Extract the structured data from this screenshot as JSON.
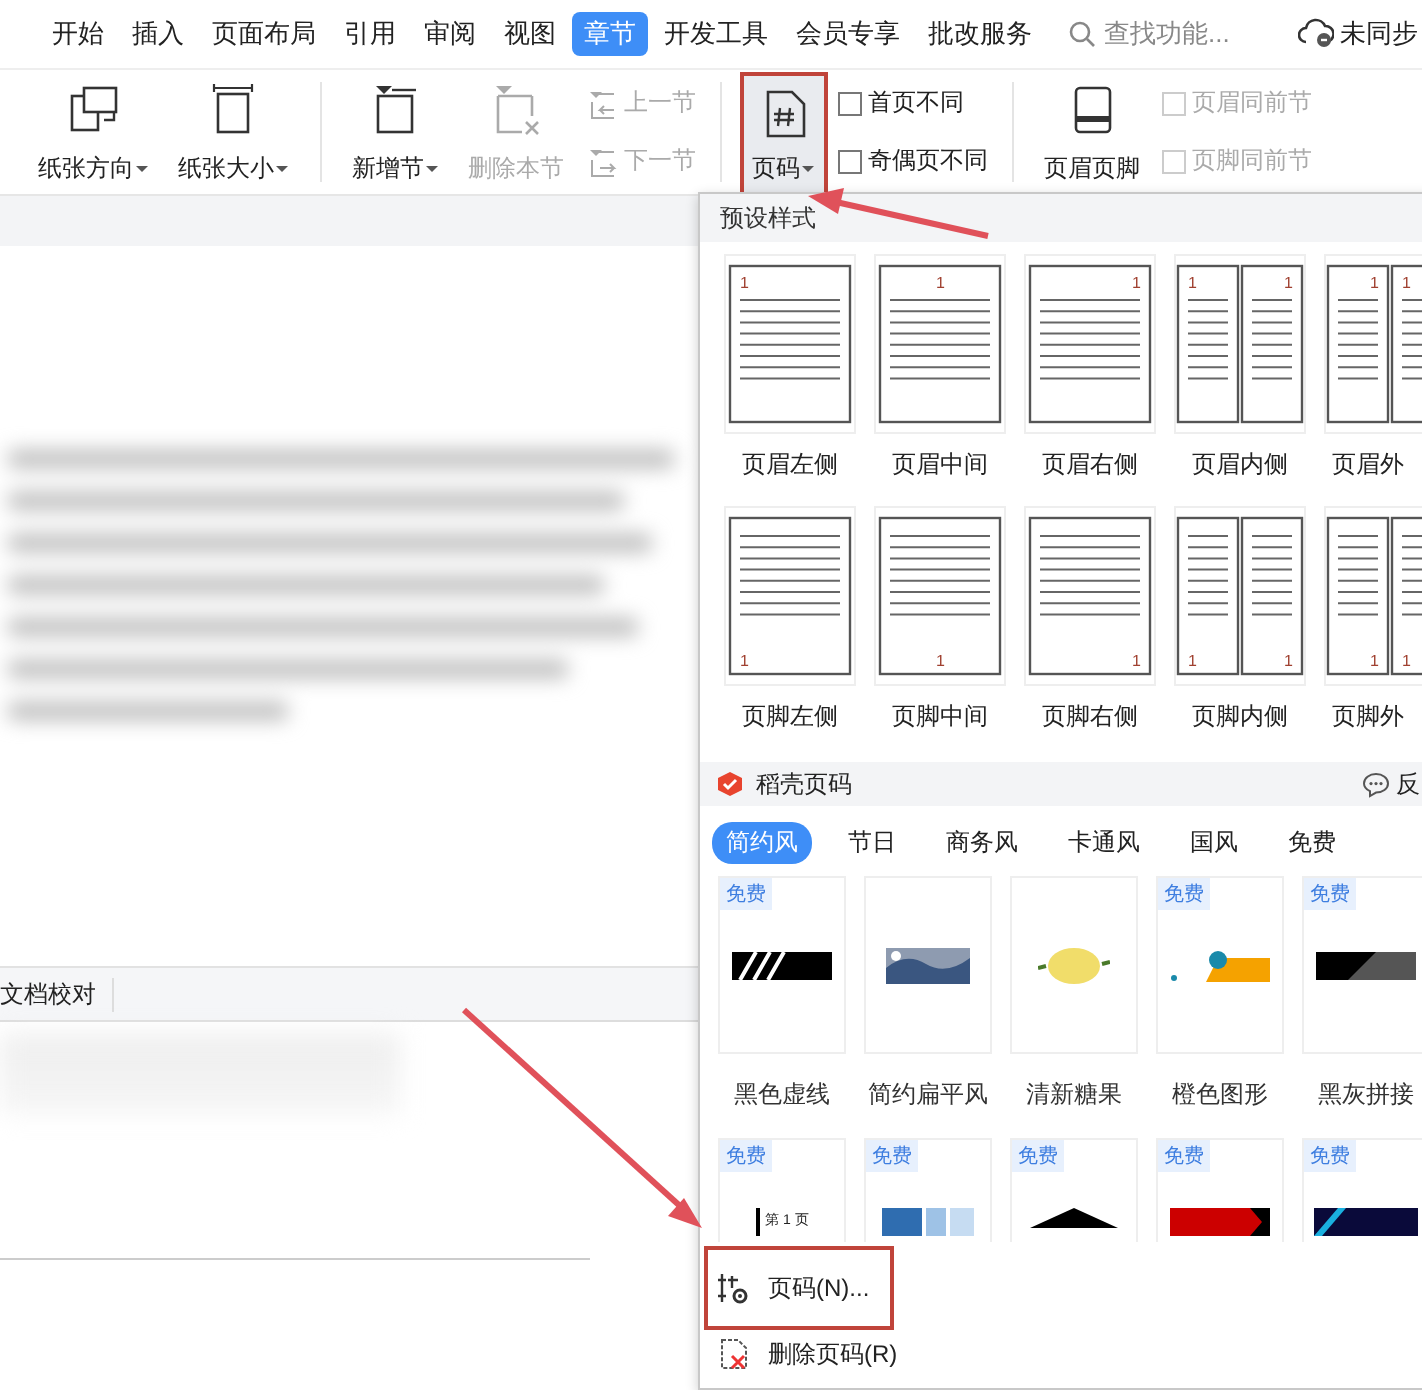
{
  "menu_tabs": [
    {
      "label": "开始",
      "selected": false
    },
    {
      "label": "插入",
      "selected": false
    },
    {
      "label": "页面布局",
      "selected": false
    },
    {
      "label": "引用",
      "selected": false
    },
    {
      "label": "审阅",
      "selected": false
    },
    {
      "label": "视图",
      "selected": false
    },
    {
      "label": "章节",
      "selected": true
    },
    {
      "label": "开发工具",
      "selected": false
    },
    {
      "label": "会员专享",
      "selected": false
    },
    {
      "label": "批改服务",
      "selected": false
    }
  ],
  "search": {
    "placeholder": "查找功能..."
  },
  "sync_status": "未同步",
  "ribbon": [
    {
      "kind": "orientation",
      "label": "纸张方向",
      "dropdown": true,
      "disabled": false,
      "highlighted": false
    },
    {
      "kind": "size",
      "label": "纸张大小",
      "dropdown": true,
      "disabled": false,
      "highlighted": false
    },
    {
      "kind": "separator"
    },
    {
      "kind": "add_section",
      "label": "新增节",
      "dropdown": true,
      "disabled": false,
      "highlighted": false
    },
    {
      "kind": "delete_section",
      "label": "删除本节",
      "dropdown": false,
      "disabled": true,
      "highlighted": false
    },
    {
      "kind": "nav",
      "items": [
        {
          "kind": "prev",
          "label": "上一节",
          "disabled": true
        },
        {
          "kind": "next",
          "label": "下一节",
          "disabled": true
        }
      ]
    },
    {
      "kind": "separator"
    },
    {
      "kind": "page_number",
      "label": "页码",
      "dropdown": true,
      "disabled": false,
      "highlighted": true
    },
    {
      "kind": "checks",
      "items": [
        {
          "label": "首页不同",
          "checked": false,
          "disabled": false
        },
        {
          "label": "奇偶页不同",
          "checked": false,
          "disabled": false
        }
      ]
    },
    {
      "kind": "separator"
    },
    {
      "kind": "header_footer",
      "label": "页眉页脚",
      "dropdown": false,
      "disabled": false,
      "highlighted": false
    },
    {
      "kind": "checks",
      "items": [
        {
          "label": "页眉同前节",
          "checked": false,
          "disabled": true
        },
        {
          "label": "页脚同前节",
          "checked": false,
          "disabled": true
        }
      ]
    }
  ],
  "proofing_bar": {
    "label": "文档校对"
  },
  "page_number_menu": {
    "preset_title": "预设样式",
    "presets": [
      {
        "label": "页眉左侧",
        "kind": "header_left",
        "numbers": [
          "1"
        ]
      },
      {
        "label": "页眉中间",
        "kind": "header_center",
        "numbers": [
          "1"
        ]
      },
      {
        "label": "页眉右侧",
        "kind": "header_right",
        "numbers": [
          "1"
        ]
      },
      {
        "label": "页眉内侧",
        "kind": "header_inside",
        "numbers": [
          "1",
          "1"
        ]
      },
      {
        "label": "页眉外",
        "kind": "header_outside",
        "numbers": [
          "1",
          "1"
        ]
      },
      {
        "label": "页脚左侧",
        "kind": "footer_left",
        "numbers": [
          "1"
        ]
      },
      {
        "label": "页脚中间",
        "kind": "footer_center",
        "numbers": [
          "1"
        ]
      },
      {
        "label": "页脚右侧",
        "kind": "footer_right",
        "numbers": [
          "1"
        ]
      },
      {
        "label": "页脚内侧",
        "kind": "footer_inside",
        "numbers": [
          "1",
          "1"
        ]
      },
      {
        "label": "页脚外",
        "kind": "footer_outside",
        "numbers": [
          "1",
          "1"
        ]
      }
    ],
    "store": {
      "title": "稻壳页码",
      "feedback": "反"
    },
    "style_tabs": [
      {
        "label": "简约风",
        "selected": true
      },
      {
        "label": "节日",
        "selected": false
      },
      {
        "label": "商务风",
        "selected": false
      },
      {
        "label": "卡通风",
        "selected": false
      },
      {
        "label": "国风",
        "selected": false
      },
      {
        "label": "免费",
        "selected": false
      }
    ],
    "templates": [
      {
        "label": "黑色虚线",
        "badge": "免费",
        "kind": "stripes"
      },
      {
        "label": "简约扁平风",
        "kind": "landscape"
      },
      {
        "label": "清新糖果",
        "kind": "lemon"
      },
      {
        "label": "橙色图形",
        "badge": "免费",
        "kind": "orange"
      },
      {
        "label": "黑灰拼接",
        "badge": "免费",
        "kind": "blackgray"
      },
      {
        "badge": "免费",
        "kind": "pagelabel",
        "preview_text": "第 1 页"
      },
      {
        "badge": "免费",
        "kind": "blueblocks"
      },
      {
        "badge": "免费",
        "kind": "diamond"
      },
      {
        "badge": "免费",
        "kind": "redarrow"
      },
      {
        "badge": "免费",
        "kind": "navy"
      }
    ],
    "actions": [
      {
        "kind": "settings",
        "label": "页码(N)...",
        "highlighted": true
      },
      {
        "kind": "delete",
        "label": "删除页码(R)",
        "highlighted": false
      }
    ]
  }
}
